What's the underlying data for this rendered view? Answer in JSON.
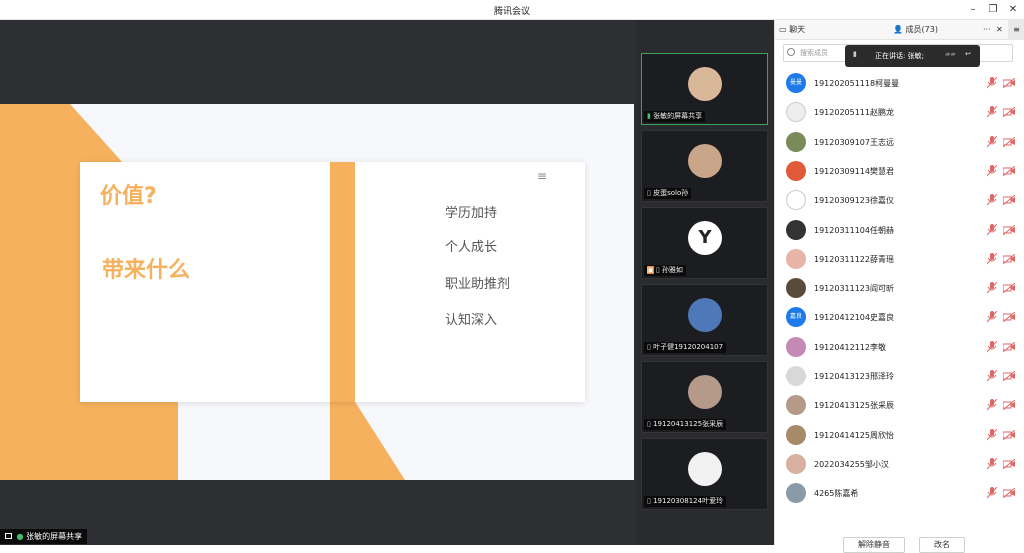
{
  "app": {
    "title": "腾讯会议"
  },
  "window_controls": {
    "minimize": "–",
    "restore": "❐",
    "close": "✕"
  },
  "slide": {
    "heading1": "价值?",
    "heading2": "带来什么",
    "items": [
      "学历加持",
      "个人成长",
      "职业助推剂",
      "认知深入"
    ]
  },
  "share_label": "张敏的屏幕共享",
  "video_tiles": [
    {
      "name": "张敏的屏幕共享",
      "avatar_color": "#d9b89a"
    },
    {
      "name": "皮蛋solo孙",
      "avatar_color": "#c9a58a"
    },
    {
      "name": "孙雅如",
      "avatar_color": "#ffffff"
    },
    {
      "name": "叶子健19120204107",
      "avatar_color": "#4f78b8"
    },
    {
      "name": "19120413125张采辰",
      "avatar_color": "#b59a8a"
    },
    {
      "name": "19120308124叶爱玲",
      "avatar_color": "#f2f2f2"
    }
  ],
  "panel": {
    "tab_chat": "聊天",
    "tab_members": "成员(73)",
    "more": "···",
    "close": "✕",
    "search_placeholder": "搜索成员",
    "speaking": "正在讲话: 张敏;",
    "members": [
      {
        "name": "191202051118柯曼曼",
        "avatar_text": "曼曼",
        "color": "#1e7ae8"
      },
      {
        "name": "19120205111赵鹏龙",
        "avatar_text": "",
        "color": "#eeeeee"
      },
      {
        "name": "19120309107王志远",
        "avatar_text": "",
        "color": "#7a8a5a"
      },
      {
        "name": "19120309114樊慧君",
        "avatar_text": "",
        "color": "#e05a3a"
      },
      {
        "name": "19120309123徐嘉仪",
        "avatar_text": "",
        "color": "#ffffff"
      },
      {
        "name": "19120311104任朝赫",
        "avatar_text": "",
        "color": "#333333"
      },
      {
        "name": "19120311122薛青瑶",
        "avatar_text": "",
        "color": "#e8b4a8"
      },
      {
        "name": "19120311123阎可昕",
        "avatar_text": "",
        "color": "#5a4a3a"
      },
      {
        "name": "19120412104史嘉良",
        "avatar_text": "嘉良",
        "color": "#1e7ae8"
      },
      {
        "name": "19120412112李敬",
        "avatar_text": "",
        "color": "#c48ab4"
      },
      {
        "name": "19120413123邢泽玲",
        "avatar_text": "",
        "color": "#d8d8d8"
      },
      {
        "name": "19120413125张采辰",
        "avatar_text": "",
        "color": "#b59a8a"
      },
      {
        "name": "19120414125周欣怡",
        "avatar_text": "",
        "color": "#a88a6a"
      },
      {
        "name": "2022034255邹小汉",
        "avatar_text": "",
        "color": "#d8b0a0"
      },
      {
        "name": "4265陈嘉希",
        "avatar_text": "",
        "color": "#8a9aa8"
      }
    ],
    "mute_all": "解除静音",
    "rename": "改名"
  }
}
